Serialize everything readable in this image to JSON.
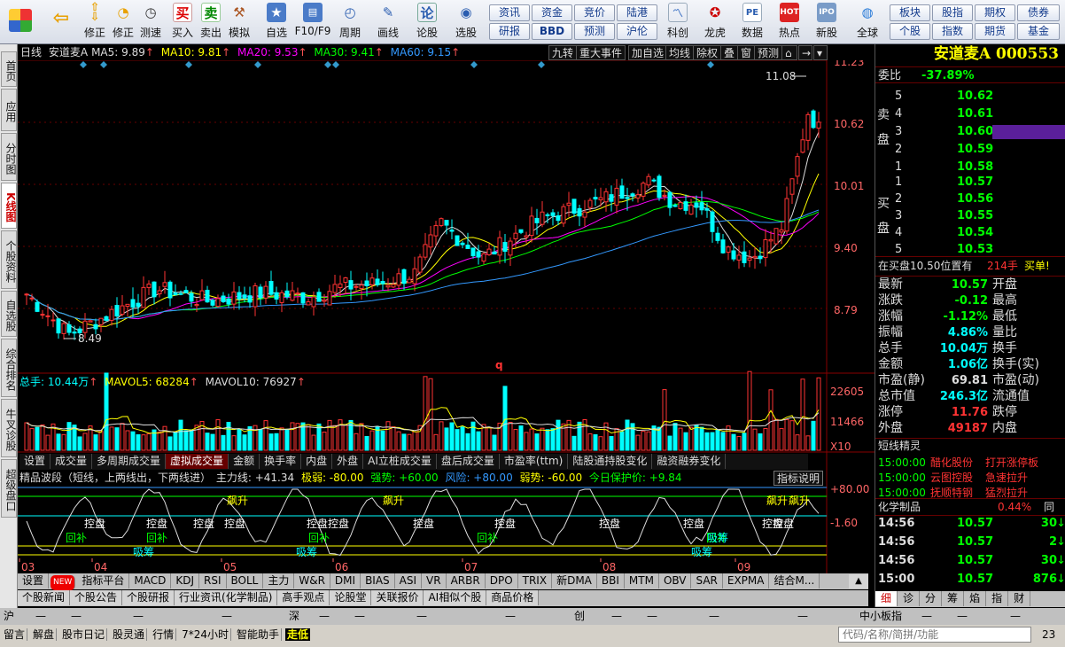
{
  "toolbar": {
    "left_buttons": [
      {
        "name": "logo-icon",
        "label": ""
      },
      {
        "name": "back-button",
        "label": ""
      },
      {
        "name": "fix-button",
        "label": "修正"
      },
      {
        "name": "measure-button",
        "label": "测速"
      },
      {
        "name": "buy-button",
        "label": "买入",
        "icon": "买"
      },
      {
        "name": "sell-button",
        "label": "卖出",
        "icon": "卖"
      },
      {
        "name": "simulate-button",
        "label": "模拟"
      },
      {
        "name": "watchlist-button",
        "label": "自选"
      },
      {
        "name": "f10-button",
        "label": "F10/F9"
      },
      {
        "name": "period-button",
        "label": "周期"
      },
      {
        "name": "draw-button",
        "label": "画线"
      },
      {
        "name": "forum-button",
        "label": "论股",
        "icon": "论"
      },
      {
        "name": "pick-button",
        "label": "选股"
      }
    ],
    "grid_buttons": [
      [
        "资讯",
        "资金",
        "竞价",
        "陆港"
      ],
      [
        "研报",
        "BBD",
        "预测",
        "沪伦"
      ]
    ],
    "icon_buttons": [
      {
        "name": "science-innovation-button",
        "label": "科创"
      },
      {
        "name": "dragon-tiger-button",
        "label": "龙虎"
      },
      {
        "name": "data-button",
        "label": "数据",
        "icon": "PE"
      },
      {
        "name": "hot-button",
        "label": "热点",
        "icon": "HOT"
      },
      {
        "name": "new-stock-button",
        "label": "新股",
        "icon": "IPO"
      },
      {
        "name": "global-button",
        "label": "全球"
      }
    ],
    "right_grid": [
      [
        "板块",
        "股指",
        "期权",
        "债券"
      ],
      [
        "个股",
        "指数",
        "期货",
        "基金"
      ]
    ]
  },
  "left_nav": [
    "首页",
    "应用",
    "分时图",
    "K线图",
    "个股资料",
    "自选股",
    "综合排名",
    "牛叉诊股",
    "超级盘口"
  ],
  "chart_header": {
    "period": "日线",
    "stock": "安道麦A",
    "ma5": "MA5: 9.89",
    "ma10": "MA10: 9.81",
    "ma20": "MA20: 9.53",
    "ma30": "MA30: 9.41",
    "ma60": "MA60: 9.15",
    "arrow": "↑",
    "tags": [
      "九转",
      "重大事件",
      "加自选",
      "均线",
      "除权",
      "叠",
      "窗",
      "预测"
    ]
  },
  "price_axis": [
    "11.23",
    "10.62",
    "10.01",
    "9.40",
    "8.79"
  ],
  "annotations": {
    "high": "11.08",
    "low": "8.49",
    "marker": "q"
  },
  "volume_header": {
    "total": "总手: 10.44万",
    "mavol5": "MAVOL5: 68284",
    "mavol10": "MAVOL10: 76927"
  },
  "volume_axis": [
    "22605",
    "11466",
    "X10"
  ],
  "indicator_tabs": [
    "设置",
    "成交量",
    "多周期成交量",
    "虚拟成交量",
    "金额",
    "换手率",
    "内盘",
    "外盘",
    "AI立桩成交量",
    "盘后成交量",
    "市盈率(ttm)",
    "陆股通持股变化",
    "融资融券变化"
  ],
  "active_indicator_tab": "虚拟成交量",
  "wave_header": {
    "title": "精品波段（短线，上两线出，下两线进）",
    "main_force": "主力线: +41.34",
    "extreme_weak": "极弱: -80.00",
    "strong": "强势: +60.00",
    "risk": "风险: +80.00",
    "weak": "弱势: -60.00",
    "protect": "今日保护价: +9.84",
    "explain": "指标说明"
  },
  "wave_axis": [
    "+80.00",
    "-1.60"
  ],
  "wave_labels": [
    "控盘",
    "回补",
    "控盘",
    "回补",
    "控盘",
    "控盘",
    "吸筹",
    "吸筹",
    "飙升",
    "控盘",
    "控盘",
    "回补",
    "飙升",
    "控盘",
    "控盘",
    "回补",
    "控盘",
    "控盘",
    "控盘",
    "吸筹",
    "回补",
    "吸筹",
    "飙升",
    "控盘",
    "飙升"
  ],
  "months": [
    "03",
    "04",
    "05",
    "06",
    "07",
    "08",
    "09"
  ],
  "bottom_tabs": [
    "设置",
    "NEW",
    "指标平台",
    "MACD",
    "KDJ",
    "RSI",
    "BOLL",
    "主力",
    "W&R",
    "DMI",
    "BIAS",
    "ASI",
    "VR",
    "ARBR",
    "DPO",
    "TRIX",
    "新DMA",
    "BBI",
    "MTM",
    "OBV",
    "SAR",
    "EXPMA",
    "结合M..."
  ],
  "bottom_tabs2": [
    "个股新闻",
    "个股公告",
    "个股研报",
    "行业资讯(化学制品)",
    "高手观点",
    "论股堂",
    "关联报价",
    "AI相似个股",
    "商品价格"
  ],
  "right_panel": {
    "title": "安道麦A 000553",
    "weibi_label": "委比",
    "weibi": "-37.89%",
    "sell_label": "卖盘",
    "buy_label": "买盘",
    "sells": [
      [
        "5",
        "10.62"
      ],
      [
        "4",
        "10.61"
      ],
      [
        "3",
        "10.60"
      ],
      [
        "2",
        "10.59"
      ],
      [
        "1",
        "10.58"
      ]
    ],
    "buys": [
      [
        "1",
        "10.57"
      ],
      [
        "2",
        "10.56"
      ],
      [
        "3",
        "10.55"
      ],
      [
        "4",
        "10.54"
      ],
      [
        "5",
        "10.53"
      ]
    ],
    "notice": "在买盘10.50位置有",
    "notice_qty": "214手",
    "notice_action": "买单!",
    "stats": [
      [
        "最新",
        "10.57",
        "开盘",
        ""
      ],
      [
        "涨跌",
        "-0.12",
        "最高",
        ""
      ],
      [
        "涨幅",
        "-1.12%",
        "最低",
        ""
      ],
      [
        "振幅",
        "4.86%",
        "量比",
        ""
      ],
      [
        "总手",
        "10.04万",
        "换手",
        ""
      ],
      [
        "金额",
        "1.06亿",
        "换手(实)",
        ""
      ],
      [
        "市盈(静)",
        "69.81",
        "市盈(动)",
        ""
      ],
      [
        "总市值",
        "246.3亿",
        "流通值",
        ""
      ],
      [
        "涨停",
        "11.76",
        "跌停",
        ""
      ],
      [
        "外盘",
        "49187",
        "内盘",
        ""
      ]
    ],
    "elf_title": "短线精灵",
    "elf": [
      [
        "15:00:00",
        "醋化股份",
        "打开涨停板"
      ],
      [
        "15:00:00",
        "云图控股",
        "急速拉升"
      ],
      [
        "15:00:00",
        "抚顺特钢",
        "猛烈拉升"
      ]
    ],
    "industry": "化学制品",
    "industry_pct": "0.44%",
    "industry_extra": "同",
    "ticks": [
      [
        "14:56",
        "10.57",
        "30"
      ],
      [
        "14:56",
        "10.57",
        "2"
      ],
      [
        "14:56",
        "10.57",
        "30"
      ],
      [
        "15:00",
        "10.57",
        "876"
      ]
    ],
    "detail_tabs": [
      "细",
      "诊",
      "分",
      "筹",
      "焰",
      "指",
      "财"
    ]
  },
  "market_bar": {
    "sh": "沪",
    "sz": "深",
    "cy": "创",
    "zxb": "中小板指",
    "dash": "—"
  },
  "status_bar": [
    "留言",
    "解盘",
    "股市日记",
    "股灵通",
    "行情",
    "7*24小时",
    "智能助手",
    "走低"
  ],
  "search_placeholder": "代码/名称/简拼/功能",
  "page_no": "23"
}
